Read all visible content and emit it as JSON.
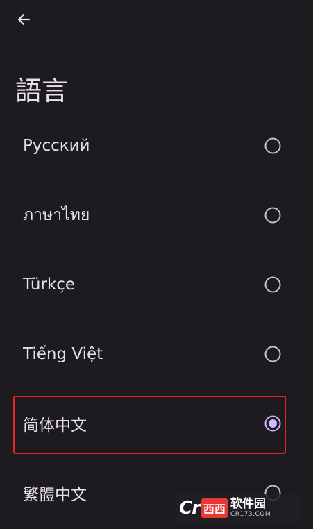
{
  "header": {
    "back_icon": "arrow-back-icon",
    "title": "語言"
  },
  "languages": [
    {
      "label": "Русский",
      "selected": false
    },
    {
      "label": "ภาษาไทย",
      "selected": false
    },
    {
      "label": "Türkçe",
      "selected": false
    },
    {
      "label": "Tiếng Việt",
      "selected": false
    },
    {
      "label": "简体中文",
      "selected": true
    },
    {
      "label": "繁體中文",
      "selected": false
    }
  ],
  "colors": {
    "background": "#1d1b20",
    "text": "#e6e1e5",
    "radio_unselected": "#c9c5d0",
    "radio_selected": "#cfbcff",
    "highlight_border": "#e0261c"
  },
  "watermark": {
    "logo_prefix": "Cr",
    "logo_badge": "西西",
    "site_name": "软件园",
    "domain": "CR173.COM"
  }
}
